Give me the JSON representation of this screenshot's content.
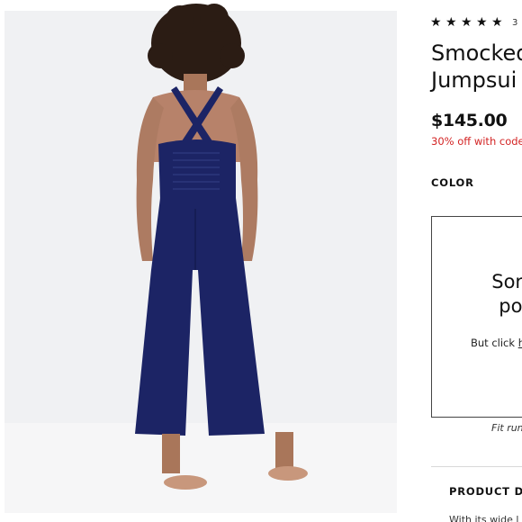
{
  "product": {
    "image_alt": "Model wearing navy smocked jumpsuit, back view",
    "rating_stars": [
      "★",
      "★",
      "★",
      "★",
      "★"
    ],
    "rating_value": 5,
    "review_count": "3",
    "title_line1": "Smocked",
    "title_line2": "Jumpsui",
    "price": "$145.00",
    "promo": "30% off with code"
  },
  "color_section": {
    "label": "COLOR",
    "popup": {
      "heading_line1": "Sorry",
      "heading_line2": "pop",
      "text_prefix": "But click ",
      "text_link": "h"
    },
    "fit_note": "Fit run"
  },
  "details": {
    "header": "PRODUCT DE",
    "text": "With its wide l"
  },
  "colors": {
    "jumpsuit": "#1c2465",
    "promo": "#d32424",
    "background": "#f0f1f3"
  }
}
